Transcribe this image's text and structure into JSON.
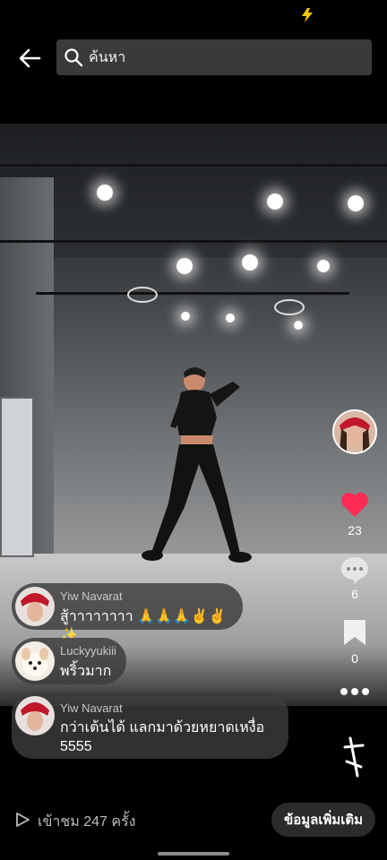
{
  "search": {
    "placeholder": "ค้นหา"
  },
  "side_actions": {
    "like_count": "23",
    "comment_count": "6",
    "bookmark_count": "0"
  },
  "comments": [
    {
      "name": "Yiw Navarat",
      "text": "สู้าาาาาาาา 🙏🙏🙏✌️✌️✨"
    },
    {
      "name": "Luckyyukiii",
      "text": "พริ้วมาก"
    },
    {
      "name": "Yiw Navarat",
      "text": "กว่าเต้นได้ แลกมาด้วยหยาดเหงื่อ 5555"
    }
  ],
  "bottom": {
    "views": "เข้าชม 247 ครั้ง",
    "more_info": "ข้อมูลเพิ่มเติม"
  },
  "colors": {
    "like": "#fe2c55",
    "search_bg": "#3a3a3a",
    "flash": "#f7c600"
  }
}
